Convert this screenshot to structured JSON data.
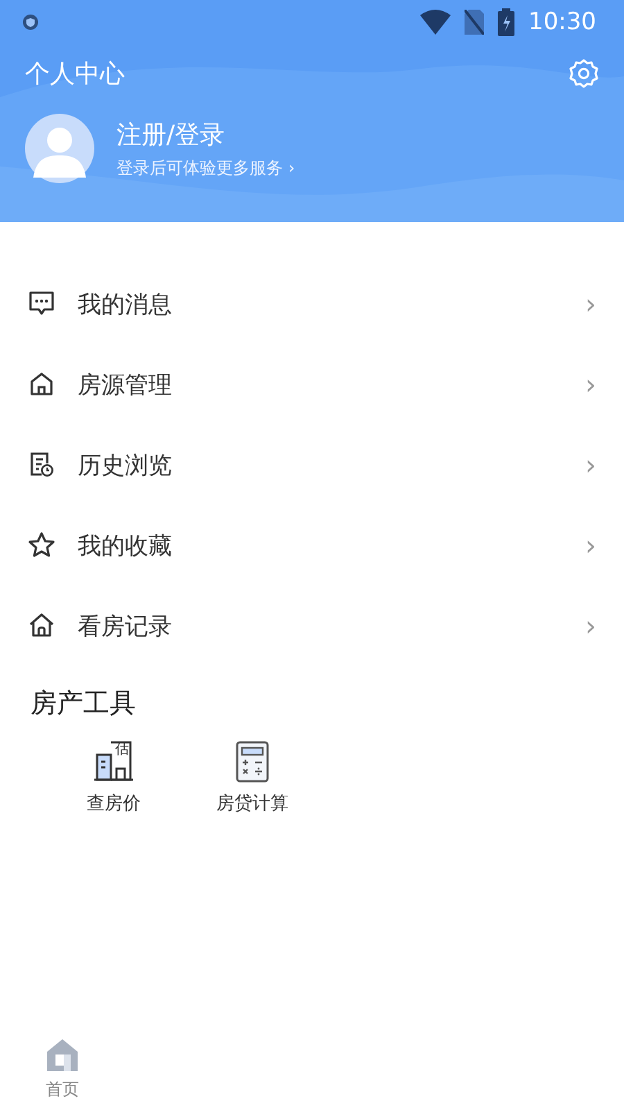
{
  "status_bar": {
    "time": "10:30"
  },
  "header": {
    "title": "个人中心"
  },
  "profile": {
    "name": "注册/登录",
    "hint": "登录后可体验更多服务",
    "hint_arrow": "›"
  },
  "menu": [
    {
      "kind": "message",
      "label": "我的消息",
      "arrow": "›"
    },
    {
      "kind": "house",
      "label": "房源管理",
      "arrow": "›"
    },
    {
      "kind": "history",
      "label": "历史浏览",
      "arrow": "›"
    },
    {
      "kind": "star",
      "label": "我的收藏",
      "arrow": "›"
    },
    {
      "kind": "home",
      "label": "看房记录",
      "arrow": "›"
    }
  ],
  "tools": {
    "title": "房产工具",
    "items": [
      {
        "kind": "building",
        "label": "查房价",
        "icon_text": "估"
      },
      {
        "kind": "calculator",
        "label": "房贷计算"
      }
    ]
  },
  "bottom_nav": [
    {
      "label": "首页",
      "selected": false
    }
  ]
}
